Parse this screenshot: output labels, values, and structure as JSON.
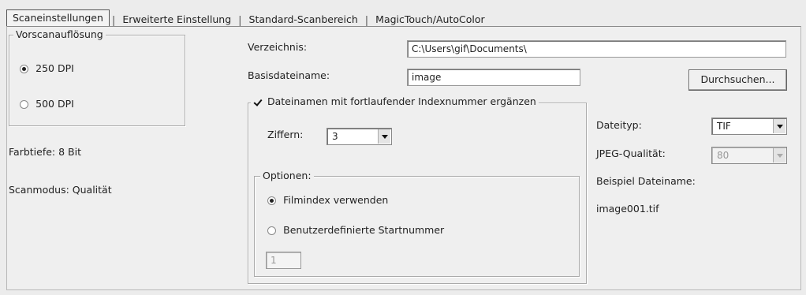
{
  "tabs": [
    {
      "label": "Scaneinstellungen",
      "active": true
    },
    {
      "label": "Erweiterte Einstellung",
      "active": false
    },
    {
      "label": "Standard-Scanbereich",
      "active": false
    },
    {
      "label": "MagicTouch/AutoColor",
      "active": false
    }
  ],
  "tab_separator": "|",
  "prescan": {
    "legend": "Vorscanauflösung",
    "option_250": "250 DPI",
    "option_500": "500 DPI",
    "selected": "250 DPI"
  },
  "color_depth": "Farbtiefe: 8 Bit",
  "scan_mode": "Scanmodus: Qualität",
  "directory": {
    "label": "Verzeichnis:",
    "value": "C:\\Users\\gif\\Documents\\"
  },
  "basename": {
    "label": "Basisdateiname:",
    "value": "image"
  },
  "browse_button": "Durchsuchen...",
  "index_group": {
    "checkbox_label": "Dateinamen mit fortlaufender Indexnummer ergänzen",
    "checked": true,
    "digits_label": "Ziffern:",
    "digits_value": "3",
    "options_legend": "Optionen:",
    "option_filmindex": "Filmindex verwenden",
    "option_custom": "Benutzerdefinierte Startnummer",
    "selected_option": "Filmindex verwenden",
    "start_number": "1"
  },
  "filetype": {
    "label": "Dateityp:",
    "value": "TIF"
  },
  "jpeg_quality": {
    "label": "JPEG-Qualität:",
    "value": "80",
    "disabled": true
  },
  "example": {
    "label": "Beispiel Dateiname:",
    "value": "image001.tif"
  }
}
